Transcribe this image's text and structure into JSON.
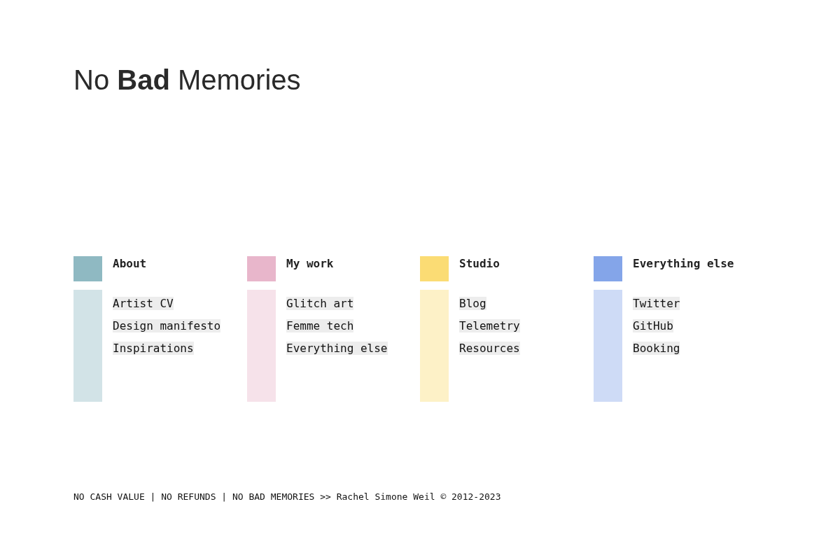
{
  "title": "No **Bad** Memories",
  "columns": [
    {
      "heading": "About",
      "color": "#8fb9c2",
      "links": [
        "Artist CV",
        "Design manifesto",
        "Inspirations"
      ]
    },
    {
      "heading": "My work",
      "color": "#e8b6cb",
      "links": [
        "Glitch art",
        "Femme tech",
        "Everything else"
      ]
    },
    {
      "heading": "Studio",
      "color": "#fbdc74",
      "links": [
        "Blog",
        "Telemetry",
        "Resources"
      ]
    },
    {
      "heading": "Everything else",
      "color": "#84a5e9",
      "links": [
        "Twitter",
        "GitHub",
        "Booking"
      ]
    }
  ],
  "footer": "NO CASH VALUE | NO REFUNDS | NO BAD MEMORIES >> Rachel Simone Weil © 2012-2023"
}
